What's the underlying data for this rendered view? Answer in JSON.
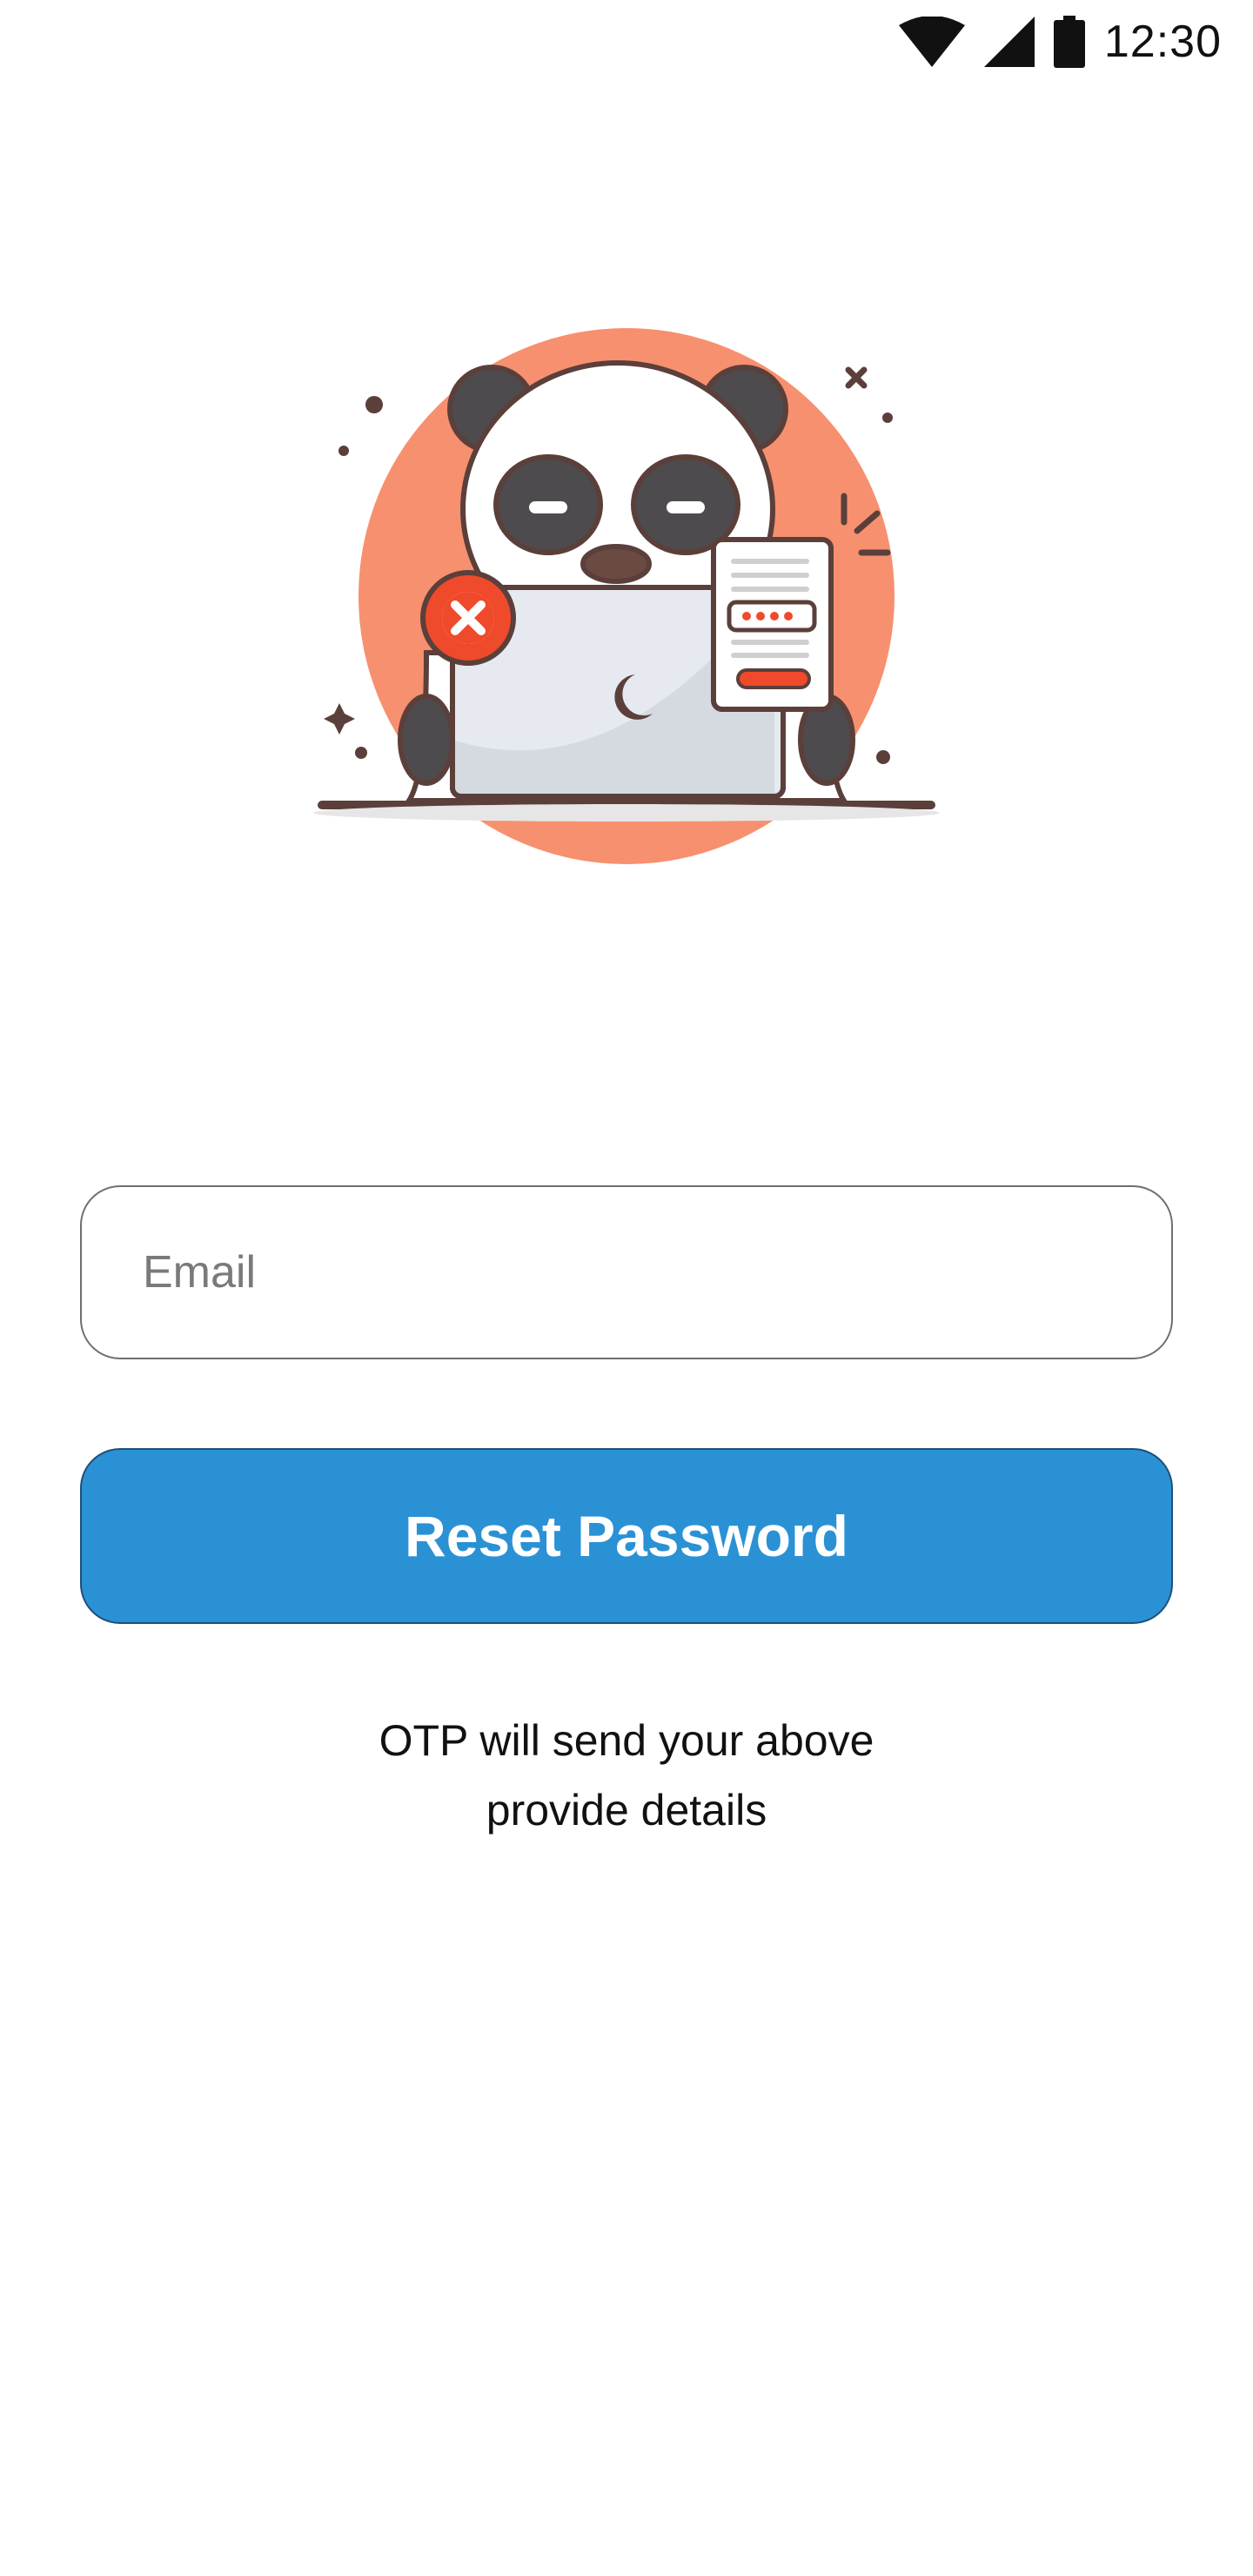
{
  "status_bar": {
    "time": "12:30",
    "icons": [
      "wifi-icon",
      "cellular-signal-icon",
      "battery-icon"
    ]
  },
  "illustration": {
    "subject": "panda-at-laptop-illustration",
    "icons": [
      "error-x-icon",
      "password-card-icon"
    ],
    "colors": {
      "circle": "#f7906f",
      "error": "#ef4a2b",
      "outline": "#5b3f3a",
      "laptop": "#e6eaf0"
    }
  },
  "form": {
    "email_placeholder": "Email",
    "email_value": "",
    "submit_label": "Reset Password"
  },
  "info": {
    "line1": "OTP will send your above",
    "line2": "provide details"
  },
  "colors": {
    "primary": "#2b91d5",
    "background": "#ffffff"
  }
}
